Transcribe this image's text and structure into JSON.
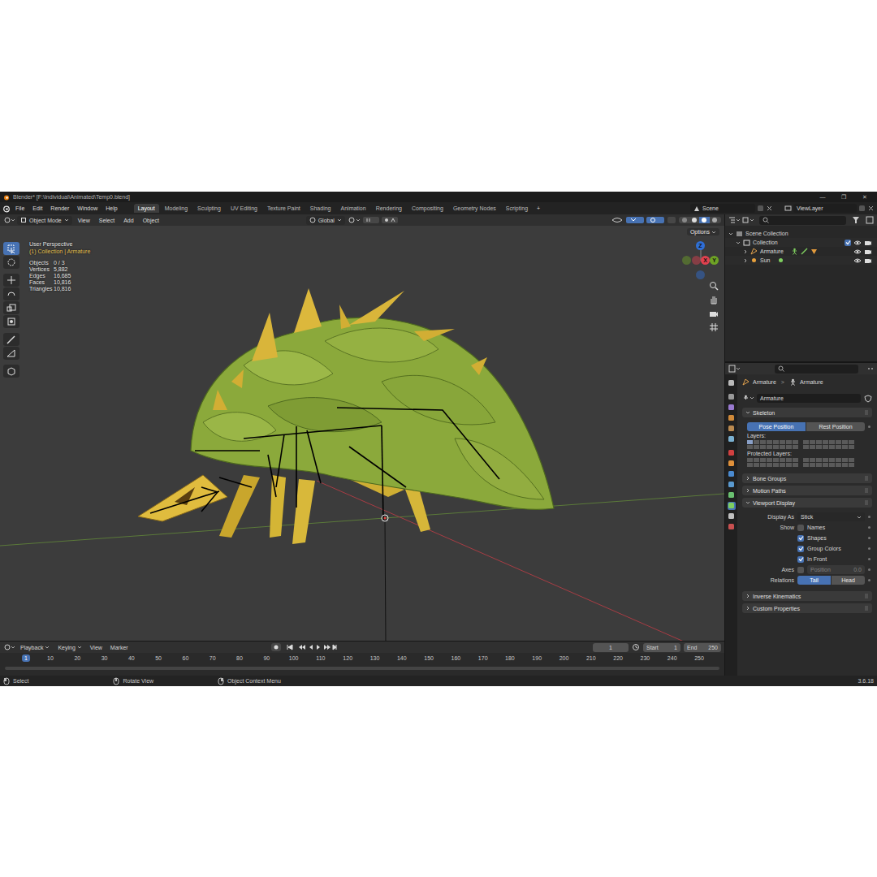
{
  "window": {
    "title": "Blender* [F:\\Individual\\Animated\\Temp0.blend]",
    "controls": [
      "—",
      "❐",
      "✕"
    ]
  },
  "menu": [
    "File",
    "Edit",
    "Render",
    "Window",
    "Help"
  ],
  "workspaces": [
    {
      "label": "Layout",
      "selected": true
    },
    {
      "label": "Modeling",
      "selected": false
    },
    {
      "label": "Sculpting",
      "selected": false
    },
    {
      "label": "UV Editing",
      "selected": false
    },
    {
      "label": "Texture Paint",
      "selected": false
    },
    {
      "label": "Shading",
      "selected": false
    },
    {
      "label": "Animation",
      "selected": false
    },
    {
      "label": "Rendering",
      "selected": false
    },
    {
      "label": "Compositing",
      "selected": false
    },
    {
      "label": "Geometry Nodes",
      "selected": false
    },
    {
      "label": "Scripting",
      "selected": false
    }
  ],
  "add_workspace": "+",
  "scene": "Scene",
  "view_layer": "ViewLayer",
  "viewport": {
    "mode": "Object Mode",
    "menus": [
      "View",
      "Select",
      "Add",
      "Object"
    ],
    "orientation": "Global",
    "options": "Options",
    "perspective": "User Perspective",
    "context": "(1) Collection | Armature",
    "stats": [
      {
        "label": "Objects",
        "value": "0 / 3"
      },
      {
        "label": "Vertices",
        "value": "5,882"
      },
      {
        "label": "Edges",
        "value": "16,685"
      },
      {
        "label": "Faces",
        "value": "10,816"
      },
      {
        "label": "Triangles",
        "value": "10,816"
      }
    ],
    "axes": [
      {
        "label": "Z",
        "color": "#2f6fd6"
      },
      {
        "label": "Y",
        "color": "#6ea325"
      },
      {
        "label": "X",
        "color": "#e0414f"
      }
    ],
    "tools": [
      {
        "selected": true
      },
      {
        "selected": false
      },
      {
        "selected": false
      },
      {
        "selected": false
      },
      {
        "selected": false
      },
      {
        "selected": false
      },
      {
        "selected": false
      },
      {
        "selected": false
      },
      {
        "selected": false
      }
    ]
  },
  "outliner": {
    "items": [
      {
        "label": "Scene Collection",
        "kind": "scene",
        "expanded": true,
        "depth": 0
      },
      {
        "label": "Collection",
        "kind": "collection",
        "expanded": true,
        "checked": true,
        "depth": 1
      },
      {
        "label": "Armature",
        "kind": "armature",
        "expanded": false,
        "depth": 2
      },
      {
        "label": "Sun",
        "kind": "light",
        "expanded": false,
        "depth": 2
      }
    ]
  },
  "properties": {
    "breadcrumb": [
      "Armature",
      "Armature"
    ],
    "sep": ">",
    "name": "Armature",
    "panels": [
      {
        "title": "Skeleton",
        "expanded": true,
        "rows": [
          {
            "kind": "toggle",
            "label": "",
            "options": [
              {
                "label": "Pose Position",
                "selected": true
              },
              {
                "label": "Rest Position",
                "selected": false
              }
            ]
          },
          {
            "kind": "layers",
            "label": "Layers:",
            "cells": [
              true,
              false,
              false,
              false,
              false,
              false,
              false,
              false,
              false,
              false,
              false,
              false,
              false,
              false,
              false,
              false,
              false,
              false,
              false,
              false,
              false,
              false,
              false,
              false,
              false,
              false,
              false,
              false,
              false,
              false,
              false,
              false
            ]
          },
          {
            "kind": "layers",
            "label": "Protected Layers:",
            "cells": [
              false,
              false,
              false,
              false,
              false,
              false,
              false,
              false,
              false,
              false,
              false,
              false,
              false,
              false,
              false,
              false,
              false,
              false,
              false,
              false,
              false,
              false,
              false,
              false,
              false,
              false,
              false,
              false,
              false,
              false,
              false,
              false
            ]
          }
        ]
      },
      {
        "title": "Bone Groups",
        "expanded": false
      },
      {
        "title": "Motion Paths",
        "expanded": false
      },
      {
        "title": "Viewport Display",
        "expanded": true,
        "rows": [
          {
            "kind": "select",
            "label": "Display As",
            "value": "Stick"
          },
          {
            "kind": "check",
            "label": "Show",
            "text": "Names",
            "checked": false
          },
          {
            "kind": "check",
            "label": "",
            "text": "Shapes",
            "checked": true
          },
          {
            "kind": "check",
            "label": "",
            "text": "Group Colors",
            "checked": true
          },
          {
            "kind": "check",
            "label": "",
            "text": "In Front",
            "checked": true
          },
          {
            "kind": "axes",
            "label": "Axes",
            "checked": false,
            "field": "Position",
            "value": "0.0"
          },
          {
            "kind": "toggle",
            "label": "Relations",
            "options": [
              {
                "label": "Tail",
                "selected": true
              },
              {
                "label": "Head",
                "selected": false
              }
            ]
          }
        ]
      },
      {
        "title": "Inverse Kinematics",
        "expanded": false
      },
      {
        "title": "Custom Properties",
        "expanded": false
      }
    ]
  },
  "timeline": {
    "menus": [
      {
        "label": "Playback",
        "dropdown": true
      },
      {
        "label": "Keying",
        "dropdown": true
      },
      {
        "label": "View",
        "dropdown": false
      },
      {
        "label": "Marker",
        "dropdown": false
      }
    ],
    "frame": "1",
    "start_label": "Start",
    "start": "1",
    "end_label": "End",
    "end": "250",
    "ruler": [
      {
        "label": "1",
        "selected": true
      },
      {
        "label": "10",
        "selected": false
      },
      {
        "label": "20",
        "selected": false
      },
      {
        "label": "30",
        "selected": false
      },
      {
        "label": "40",
        "selected": false
      },
      {
        "label": "50",
        "selected": false
      },
      {
        "label": "60",
        "selected": false
      },
      {
        "label": "70",
        "selected": false
      },
      {
        "label": "80",
        "selected": false
      },
      {
        "label": "90",
        "selected": false
      },
      {
        "label": "100",
        "selected": false
      },
      {
        "label": "110",
        "selected": false
      },
      {
        "label": "120",
        "selected": false
      },
      {
        "label": "130",
        "selected": false
      },
      {
        "label": "140",
        "selected": false
      },
      {
        "label": "150",
        "selected": false
      },
      {
        "label": "160",
        "selected": false
      },
      {
        "label": "170",
        "selected": false
      },
      {
        "label": "180",
        "selected": false
      },
      {
        "label": "190",
        "selected": false
      },
      {
        "label": "200",
        "selected": false
      },
      {
        "label": "210",
        "selected": false
      },
      {
        "label": "220",
        "selected": false
      },
      {
        "label": "230",
        "selected": false
      },
      {
        "label": "240",
        "selected": false
      },
      {
        "label": "250",
        "selected": false
      }
    ]
  },
  "status": {
    "items": [
      "Select",
      "Rotate View",
      "Object Context Menu"
    ],
    "version": "3.6.18"
  }
}
